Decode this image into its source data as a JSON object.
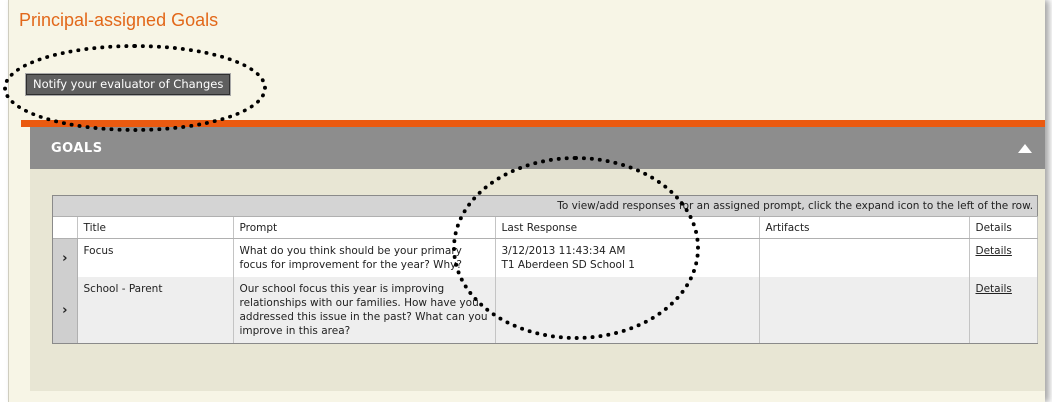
{
  "page": {
    "title": "Principal-assigned Goals"
  },
  "toolbar": {
    "notify_label": "Notify your evaluator of Changes"
  },
  "goals": {
    "title": "GOALS",
    "collapse_icon": "collapse-up-icon",
    "hint": "To view/add responses for an assigned prompt, click the expand icon to the left of the row.",
    "columns": [
      "Title",
      "Prompt",
      "Last Response",
      "Artifacts",
      "Details"
    ],
    "rows": [
      {
        "title": "Focus",
        "prompt": "What do you think should be your primary focus for improvement for the year? Why?",
        "last_response_date": "3/12/2013 11:43:34 AM",
        "last_response_by": "T1 Aberdeen SD School 1",
        "artifacts": "",
        "details": "Details"
      },
      {
        "title": "School - Parent",
        "prompt": "Our school focus this year is improving relationships with our families. How have you addressed this issue in the past? What can you improve in this area?",
        "last_response_date": "",
        "last_response_by": "",
        "artifacts": "",
        "details": "Details"
      }
    ]
  },
  "colors": {
    "accent": "#e2681a",
    "bar": "#ea5a10",
    "header": "#8d8d8d"
  }
}
